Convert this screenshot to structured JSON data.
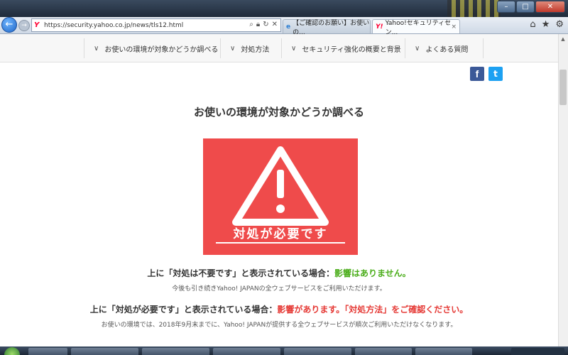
{
  "browser": {
    "url": "https://security.yahoo.co.jp/news/tls12.html",
    "tabs": [
      {
        "label": "【ご確認のお願い】お使いの...",
        "icon": "ie-icon"
      },
      {
        "label": "Yahoo!セキュリティセン...",
        "icon": "yahoo-icon",
        "close": "×"
      }
    ]
  },
  "nav": {
    "items": [
      {
        "label": "お使いの環境が対象かどうか調べる"
      },
      {
        "label": "対処方法"
      },
      {
        "label": "セキュリティ強化の概要と背景"
      },
      {
        "label": "よくある質問"
      }
    ]
  },
  "share": {
    "facebook": "f",
    "twitter": "t"
  },
  "main": {
    "heading": "お使いの環境が対象かどうか調べる",
    "alert_label": "対処が必要です",
    "line1_prefix": "上に「対処は不要です」と表示されている場合：",
    "line1_status": "影響はありません。",
    "line1_sub": "今後も引き続きYahoo! JAPANの全ウェブサービスをご利用いただけます。",
    "line2_prefix": "上に「対処が必要です」と表示されている場合：",
    "line2_status": "影響があります。「対処方法」をご確認ください。",
    "line2_sub": "お使いの環境では、2018年9月末までに、Yahoo! JAPANが提供する全ウェブサービスが順次ご利用いただけなくなります。"
  },
  "colors": {
    "alert_bg": "#ef4b4b",
    "ok_green": "#4cae1c",
    "warn_red": "#e53935",
    "facebook": "#3b5998",
    "twitter": "#1da1f2"
  }
}
